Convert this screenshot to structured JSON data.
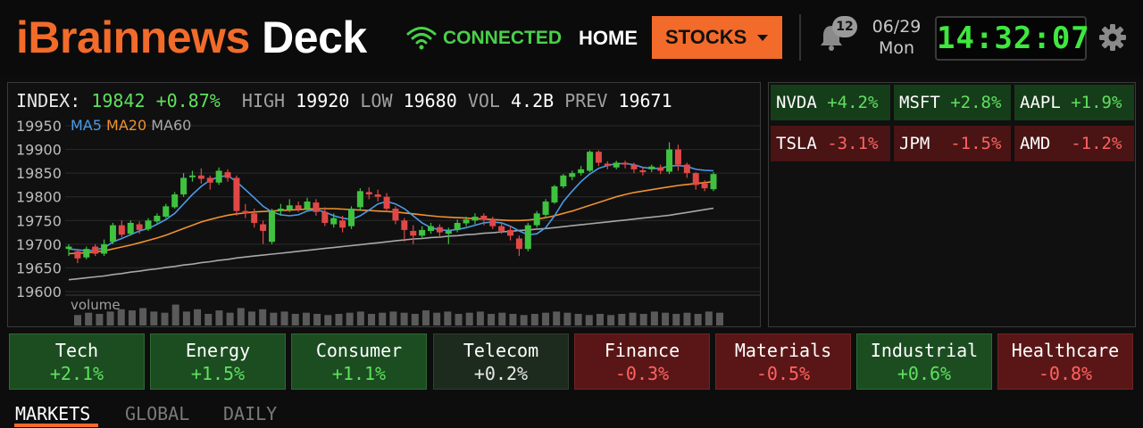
{
  "header": {
    "brand_part1": "iBrainnews",
    "brand_part2": "Deck",
    "connection_status": "CONNECTED",
    "nav_home": "HOME",
    "nav_stocks": "STOCKS",
    "notification_count": "12",
    "date": "06/29",
    "weekday": "Mon",
    "clock": "14:32:07"
  },
  "index_bar": {
    "label": "INDEX:",
    "value": "19842",
    "change": "+0.87%",
    "high_label": "HIGH",
    "high": "19920",
    "low_label": "LOW",
    "low": "19680",
    "vol_label": "VOL",
    "vol": "4.2B",
    "prev_label": "PREV",
    "prev": "19671"
  },
  "legend": {
    "ma5": "MA5",
    "ma20": "MA20",
    "ma60": "MA60",
    "volume": "volume"
  },
  "chart_data": {
    "type": "candlestick",
    "ylim": [
      19600,
      19950
    ],
    "yticks": [
      "19950",
      "19900",
      "19850",
      "19800",
      "19750",
      "19700",
      "19650",
      "19600"
    ],
    "candles": [
      [
        19690,
        19695,
        19675,
        19700
      ],
      [
        19685,
        19670,
        19660,
        19690
      ],
      [
        19672,
        19690,
        19668,
        19695
      ],
      [
        19695,
        19680,
        19675,
        19700
      ],
      [
        19680,
        19700,
        19675,
        19710
      ],
      [
        19705,
        19740,
        19700,
        19745
      ],
      [
        19740,
        19720,
        19715,
        19750
      ],
      [
        19722,
        19745,
        19718,
        19750
      ],
      [
        19742,
        19730,
        19722,
        19748
      ],
      [
        19732,
        19750,
        19728,
        19755
      ],
      [
        19748,
        19760,
        19744,
        19765
      ],
      [
        19758,
        19780,
        19755,
        19785
      ],
      [
        19778,
        19805,
        19775,
        19810
      ],
      [
        19805,
        19840,
        19800,
        19850
      ],
      [
        19842,
        19845,
        19832,
        19855
      ],
      [
        19845,
        19838,
        19828,
        19860
      ],
      [
        19840,
        19830,
        19815,
        19845
      ],
      [
        19830,
        19855,
        19825,
        19862
      ],
      [
        19852,
        19840,
        19832,
        19858
      ],
      [
        19840,
        19770,
        19760,
        19845
      ],
      [
        19770,
        19765,
        19755,
        19785
      ],
      [
        19765,
        19745,
        19735,
        19775
      ],
      [
        19742,
        19728,
        19700,
        19750
      ],
      [
        19705,
        19770,
        19700,
        19775
      ],
      [
        19770,
        19775,
        19760,
        19785
      ],
      [
        19773,
        19782,
        19768,
        19795
      ],
      [
        19782,
        19775,
        19768,
        19790
      ],
      [
        19775,
        19790,
        19770,
        19798
      ],
      [
        19788,
        19768,
        19760,
        19795
      ],
      [
        19768,
        19745,
        19738,
        19778
      ],
      [
        19742,
        19755,
        19735,
        19765
      ],
      [
        19750,
        19735,
        19725,
        19760
      ],
      [
        19738,
        19775,
        19732,
        19780
      ],
      [
        19778,
        19812,
        19770,
        19818
      ],
      [
        19810,
        19805,
        19795,
        19820
      ],
      [
        19805,
        19800,
        19790,
        19815
      ],
      [
        19800,
        19775,
        19768,
        19808
      ],
      [
        19775,
        19750,
        19742,
        19780
      ],
      [
        19750,
        19730,
        19705,
        19755
      ],
      [
        19728,
        19718,
        19700,
        19740
      ],
      [
        19718,
        19730,
        19712,
        19738
      ],
      [
        19728,
        19738,
        19722,
        19745
      ],
      [
        19736,
        19725,
        19715,
        19742
      ],
      [
        19722,
        19728,
        19700,
        19735
      ],
      [
        19730,
        19745,
        19725,
        19752
      ],
      [
        19744,
        19752,
        19738,
        19758
      ],
      [
        19750,
        19758,
        19742,
        19765
      ],
      [
        19760,
        19752,
        19740,
        19765
      ],
      [
        19752,
        19738,
        19732,
        19758
      ],
      [
        19738,
        19728,
        19722,
        19745
      ],
      [
        19730,
        19718,
        19708,
        19738
      ],
      [
        19712,
        19690,
        19675,
        19718
      ],
      [
        19690,
        19740,
        19685,
        19745
      ],
      [
        19740,
        19765,
        19735,
        19770
      ],
      [
        19762,
        19790,
        19758,
        19795
      ],
      [
        19788,
        19822,
        19785,
        19825
      ],
      [
        19822,
        19845,
        19818,
        19848
      ],
      [
        19842,
        19850,
        19835,
        19855
      ],
      [
        19850,
        19858,
        19845,
        19865
      ],
      [
        19855,
        19895,
        19852,
        19898
      ],
      [
        19895,
        19872,
        19865,
        19898
      ],
      [
        19870,
        19865,
        19858,
        19875
      ],
      [
        19862,
        19872,
        19858,
        19876
      ],
      [
        19872,
        19868,
        19860,
        19876
      ],
      [
        19868,
        19858,
        19850,
        19872
      ],
      [
        19856,
        19852,
        19845,
        19862
      ],
      [
        19858,
        19864,
        19852,
        19868
      ],
      [
        19862,
        19855,
        19848,
        19868
      ],
      [
        19853,
        19900,
        19848,
        19915
      ],
      [
        19900,
        19868,
        19855,
        19910
      ],
      [
        19868,
        19850,
        19840,
        19872
      ],
      [
        19850,
        19825,
        19815,
        19852
      ],
      [
        19828,
        19818,
        19812,
        19835
      ],
      [
        19816,
        19848,
        19812,
        19852
      ]
    ],
    "ma5": [
      19690,
      19688,
      19686,
      19688,
      19692,
      19705,
      19712,
      19720,
      19728,
      19733,
      19742,
      19752,
      19765,
      19785,
      19805,
      19822,
      19835,
      19842,
      19845,
      19832,
      19815,
      19798,
      19780,
      19768,
      19762,
      19760,
      19762,
      19770,
      19773,
      19768,
      19760,
      19755,
      19752,
      19760,
      19772,
      19785,
      19790,
      19785,
      19775,
      19760,
      19745,
      19735,
      19730,
      19729,
      19731,
      19735,
      19740,
      19745,
      19747,
      19745,
      19738,
      19728,
      19720,
      19722,
      19735,
      19760,
      19790,
      19812,
      19832,
      19848,
      19860,
      19866,
      19870,
      19870,
      19868,
      19862,
      19860,
      19860,
      19865,
      19866,
      19864,
      19858,
      19856,
      19855
    ],
    "ma20": [
      19680,
      19681,
      19682,
      19684,
      19686,
      19690,
      19694,
      19698,
      19703,
      19708,
      19713,
      19719,
      19726,
      19733,
      19740,
      19747,
      19752,
      19757,
      19761,
      19764,
      19766,
      19768,
      19769,
      19770,
      19771,
      19772,
      19773,
      19774,
      19775,
      19775,
      19775,
      19774,
      19773,
      19772,
      19771,
      19770,
      19769,
      19768,
      19766,
      19764,
      19762,
      19760,
      19758,
      19757,
      19756,
      19755,
      19754,
      19753,
      19752,
      19751,
      19750,
      19750,
      19751,
      19753,
      19756,
      19760,
      19765,
      19770,
      19776,
      19782,
      19788,
      19794,
      19800,
      19805,
      19809,
      19812,
      19815,
      19818,
      19821,
      19824,
      19826,
      19828,
      19830,
      19832
    ],
    "ma60": [
      19625,
      19627,
      19629,
      19631,
      19633,
      19636,
      19638,
      19641,
      19643,
      19646,
      19648,
      19651,
      19653,
      19656,
      19658,
      19661,
      19663,
      19666,
      19668,
      19671,
      19673,
      19675,
      19677,
      19679,
      19681,
      19683,
      19685,
      19687,
      19689,
      19691,
      19693,
      19695,
      19697,
      19699,
      19701,
      19703,
      19705,
      19707,
      19709,
      19711,
      19712,
      19714,
      19715,
      19717,
      19718,
      19720,
      19721,
      19723,
      19724,
      19726,
      19727,
      19729,
      19730,
      19732,
      19733,
      19735,
      19737,
      19739,
      19741,
      19743,
      19745,
      19747,
      19749,
      19751,
      19753,
      19755,
      19757,
      19759,
      19761,
      19764,
      19767,
      19770,
      19773,
      19776
    ],
    "volume": [
      0.45,
      0.55,
      0.5,
      0.6,
      0.7,
      0.65,
      0.75,
      0.6,
      0.55,
      0.9,
      0.6,
      0.7,
      0.5,
      0.65,
      0.55,
      0.75,
      0.6,
      0.7,
      0.55,
      0.6,
      0.5,
      0.55,
      0.5,
      0.45,
      0.5,
      0.55,
      0.6,
      0.5,
      0.55,
      0.6,
      0.55,
      0.5,
      0.65,
      0.55,
      0.6,
      0.5,
      0.55,
      0.6,
      0.5,
      0.55,
      0.5,
      0.45,
      0.5,
      0.55,
      0.6,
      0.55,
      0.5,
      0.45,
      0.5,
      0.45,
      0.5,
      0.55,
      0.5,
      0.6,
      0.55,
      0.5,
      0.55,
      0.5,
      0.6,
      0.55
    ]
  },
  "tickers": [
    {
      "symbol": "NVDA",
      "change": "+4.2%",
      "dir": "up"
    },
    {
      "symbol": "MSFT",
      "change": "+2.8%",
      "dir": "up"
    },
    {
      "symbol": "AAPL",
      "change": "+1.9%",
      "dir": "up"
    },
    {
      "symbol": "TSLA",
      "change": "-3.1%",
      "dir": "dn"
    },
    {
      "symbol": "JPM",
      "change": "-1.5%",
      "dir": "dn"
    },
    {
      "symbol": "AMD",
      "change": "-1.2%",
      "dir": "dn"
    }
  ],
  "sectors": [
    {
      "name": "Tech",
      "change": "+2.1%"
    },
    {
      "name": "Energy",
      "change": "+1.5%"
    },
    {
      "name": "Consumer",
      "change": "+1.1%"
    },
    {
      "name": "Telecom",
      "change": "+0.2%"
    },
    {
      "name": "Finance",
      "change": "-0.3%"
    },
    {
      "name": "Materials",
      "change": "-0.5%"
    },
    {
      "name": "Industrial",
      "change": "+0.6%"
    },
    {
      "name": "Healthcare",
      "change": "-0.8%"
    }
  ],
  "tabs": [
    "MARKETS",
    "GLOBAL",
    "DAILY"
  ],
  "colors": {
    "accent": "#f26b2a",
    "up": "#3fc23f",
    "down": "#e04848",
    "ma5": "#4b9be8",
    "ma20": "#f0922e",
    "ma60": "#a8a8a8"
  }
}
